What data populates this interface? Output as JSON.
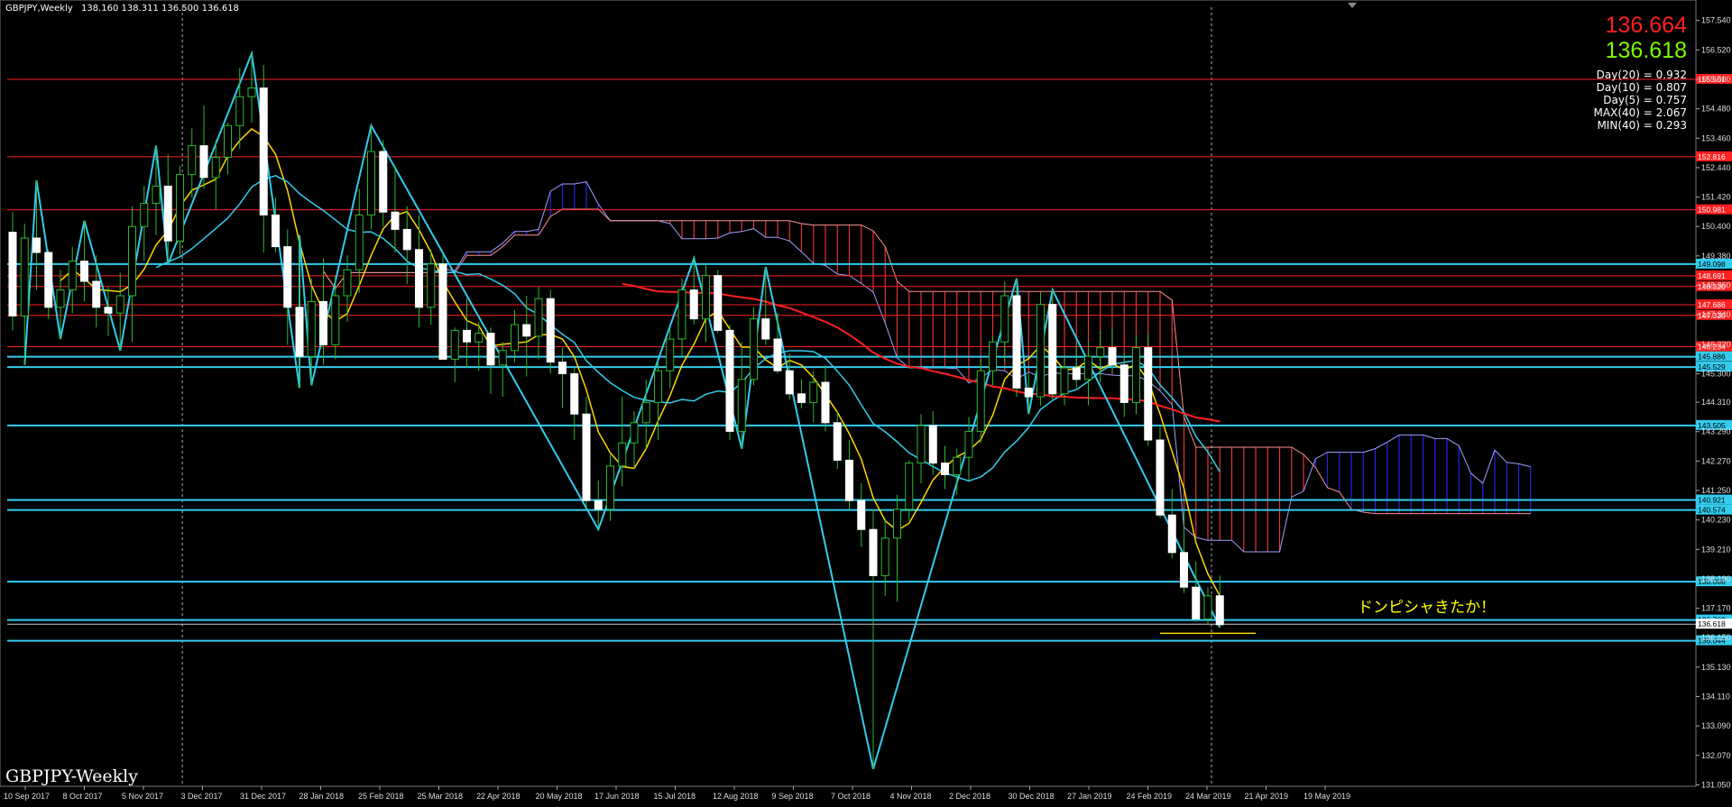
{
  "header": {
    "symbol_tf": "GBPJPY,Weekly",
    "ohlc": "138.160 138.311 136.500 136.618"
  },
  "corner_label": "GBPJPY-Weekly",
  "prices": {
    "bid": "136.664",
    "ask": "136.618",
    "bid_color": "#ff2020",
    "ask_color": "#7cfc00"
  },
  "stats": [
    "Day(20) = 0.932",
    "Day(10) = 0.807",
    "Day(5) = 0.757",
    "MAX(40) = 2.067",
    "MIN(40) = 0.293"
  ],
  "annotation": "ドンピシャきたか！",
  "colors": {
    "background": "#000000",
    "bull_candle": "#ffffff",
    "bear_candle": "#ffffff",
    "wick": "#2eb82e",
    "hline_red": "#ff2020",
    "hline_cyan": "#33ccee",
    "ma_yellow": "#ffd700",
    "ma_cyan": "#33ccee",
    "ma_red": "#ff2020",
    "zigzag": "#33ccee",
    "cloud_bull": "#2a2aff",
    "cloud_bear": "#ff3b3b"
  },
  "chart_data": {
    "type": "candlestick",
    "ylim": [
      131.0,
      158.0
    ],
    "yticks": [
      157.54,
      156.52,
      155.5,
      154.48,
      153.46,
      152.44,
      151.42,
      150.4,
      149.38,
      148.36,
      147.34,
      146.32,
      145.3,
      144.31,
      143.29,
      142.27,
      141.25,
      140.23,
      139.21,
      138.19,
      137.17,
      136.15,
      135.13,
      134.11,
      133.09,
      132.07,
      131.05
    ],
    "x_labels": [
      "10 Sep 2017",
      "8 Oct 2017",
      "5 Nov 2017",
      "3 Dec 2017",
      "31 Dec 2017",
      "28 Jan 2018",
      "25 Feb 2018",
      "25 Mar 2018",
      "22 Apr 2018",
      "20 May 2018",
      "17 Jun 2018",
      "15 Jul 2018",
      "12 Aug 2018",
      "9 Sep 2018",
      "7 Oct 2018",
      "4 Nov 2018",
      "2 Dec 2018",
      "30 Dec 2018",
      "27 Jan 2019",
      "24 Feb 2019",
      "24 Mar 2019",
      "21 Apr 2019",
      "19 May 2019"
    ],
    "price_levels": [
      {
        "value": 155.501,
        "color": "#ff2020",
        "label": "155.501"
      },
      {
        "value": 152.816,
        "color": "#ff2020",
        "label": "152.816"
      },
      {
        "value": 150.981,
        "color": "#ff2020",
        "label": "150.981"
      },
      {
        "value": 149.098,
        "color": "#33ccee",
        "label": "149.098"
      },
      {
        "value": 148.691,
        "color": "#ff2020",
        "label": "148.691"
      },
      {
        "value": 148.32,
        "color": "#ff2020",
        "label": "148.320"
      },
      {
        "value": 147.686,
        "color": "#ff2020",
        "label": "147.686"
      },
      {
        "value": 147.32,
        "color": "#ff2020",
        "label": "147.320"
      },
      {
        "value": 146.234,
        "color": "#ff2020",
        "label": "146.234"
      },
      {
        "value": 145.886,
        "color": "#33ccee",
        "label": "145.886"
      },
      {
        "value": 145.529,
        "color": "#33ccee",
        "label": "145.529"
      },
      {
        "value": 143.505,
        "color": "#33ccee",
        "label": "143.505"
      },
      {
        "value": 140.921,
        "color": "#33ccee",
        "label": "140.921"
      },
      {
        "value": 140.574,
        "color": "#33ccee",
        "label": "140.574"
      },
      {
        "value": 138.088,
        "color": "#33ccee",
        "label": "138.088"
      },
      {
        "value": 136.763,
        "color": "#33ccee",
        "label": "136.763"
      },
      {
        "value": 136.618,
        "color": "#cccccc",
        "label": "136.618"
      },
      {
        "value": 136.044,
        "color": "#33ccee",
        "label": "136.044"
      }
    ],
    "candles": [
      [
        150.2,
        150.9,
        146.8,
        147.3
      ],
      [
        147.3,
        150.5,
        145.6,
        150.0
      ],
      [
        150.0,
        152.0,
        148.2,
        149.5
      ],
      [
        149.5,
        149.6,
        147.2,
        147.6
      ],
      [
        147.6,
        148.9,
        146.5,
        148.2
      ],
      [
        148.2,
        149.7,
        147.4,
        149.2
      ],
      [
        149.2,
        150.6,
        147.8,
        148.5
      ],
      [
        148.5,
        149.4,
        146.9,
        147.6
      ],
      [
        147.6,
        148.3,
        146.6,
        147.4
      ],
      [
        147.4,
        148.8,
        146.1,
        148.0
      ],
      [
        148.0,
        151.1,
        146.4,
        150.4
      ],
      [
        150.4,
        151.8,
        149.2,
        151.2
      ],
      [
        151.2,
        153.2,
        150.1,
        151.8
      ],
      [
        151.8,
        152.9,
        149.1,
        149.9
      ],
      [
        149.9,
        152.5,
        149.4,
        152.2
      ],
      [
        152.2,
        153.8,
        151.4,
        153.2
      ],
      [
        153.2,
        154.6,
        151.7,
        152.1
      ],
      [
        152.1,
        153.4,
        151.0,
        152.8
      ],
      [
        152.8,
        154.0,
        152.2,
        153.9
      ],
      [
        153.9,
        155.9,
        153.1,
        154.9
      ],
      [
        154.9,
        156.4,
        154.0,
        155.2
      ],
      [
        155.2,
        156.0,
        149.5,
        150.8
      ],
      [
        150.8,
        151.4,
        149.5,
        149.7
      ],
      [
        149.7,
        150.3,
        146.3,
        147.6
      ],
      [
        147.6,
        150.1,
        144.8,
        145.9
      ],
      [
        145.9,
        148.6,
        144.9,
        147.8
      ],
      [
        147.8,
        149.3,
        145.6,
        146.3
      ],
      [
        146.3,
        148.7,
        145.8,
        148.0
      ],
      [
        148.0,
        149.4,
        147.1,
        148.9
      ],
      [
        148.9,
        151.7,
        148.1,
        150.8
      ],
      [
        150.8,
        153.9,
        150.3,
        153.0
      ],
      [
        153.0,
        153.4,
        150.4,
        150.9
      ],
      [
        150.9,
        152.5,
        149.5,
        150.3
      ],
      [
        150.3,
        151.1,
        148.4,
        149.6
      ],
      [
        149.6,
        150.8,
        146.9,
        147.6
      ],
      [
        147.6,
        149.6,
        147.0,
        149.1
      ],
      [
        149.1,
        149.4,
        146.2,
        145.8
      ],
      [
        145.8,
        146.9,
        145.0,
        146.8
      ],
      [
        146.8,
        147.9,
        145.5,
        146.4
      ],
      [
        146.4,
        147.1,
        145.4,
        146.7
      ],
      [
        146.7,
        146.9,
        144.6,
        145.6
      ],
      [
        145.6,
        146.4,
        144.5,
        146.1
      ],
      [
        146.1,
        147.5,
        145.7,
        147.0
      ],
      [
        147.0,
        148.0,
        145.2,
        146.6
      ],
      [
        146.6,
        148.3,
        145.8,
        147.9
      ],
      [
        147.9,
        148.2,
        145.3,
        145.7
      ],
      [
        145.7,
        146.2,
        144.1,
        145.3
      ],
      [
        145.3,
        145.5,
        143.0,
        143.9
      ],
      [
        143.9,
        144.5,
        140.6,
        140.9
      ],
      [
        140.9,
        141.6,
        139.9,
        140.6
      ],
      [
        140.6,
        142.5,
        140.2,
        142.1
      ],
      [
        142.1,
        144.5,
        141.4,
        142.9
      ],
      [
        142.9,
        144.0,
        142.0,
        143.6
      ],
      [
        143.6,
        145.1,
        142.7,
        144.3
      ],
      [
        144.3,
        145.7,
        143.0,
        145.4
      ],
      [
        145.4,
        146.9,
        144.8,
        146.5
      ],
      [
        146.5,
        148.6,
        145.9,
        148.2
      ],
      [
        148.2,
        149.3,
        147.0,
        147.2
      ],
      [
        147.2,
        149.1,
        146.4,
        148.7
      ],
      [
        148.7,
        148.9,
        146.7,
        146.8
      ],
      [
        146.8,
        147.0,
        143.0,
        143.3
      ],
      [
        143.3,
        146.4,
        142.7,
        145.1
      ],
      [
        145.1,
        147.6,
        144.9,
        147.2
      ],
      [
        147.2,
        149.0,
        146.3,
        146.5
      ],
      [
        146.5,
        147.4,
        145.3,
        145.4
      ],
      [
        145.4,
        146.0,
        144.4,
        144.6
      ],
      [
        144.6,
        145.1,
        144.1,
        144.3
      ],
      [
        144.3,
        145.4,
        143.6,
        145.0
      ],
      [
        145.0,
        145.6,
        143.3,
        143.6
      ],
      [
        143.6,
        144.0,
        142.0,
        142.3
      ],
      [
        142.3,
        143.0,
        140.6,
        140.9
      ],
      [
        140.9,
        141.5,
        139.3,
        139.9
      ],
      [
        139.9,
        140.6,
        131.6,
        138.3
      ],
      [
        138.3,
        140.3,
        137.6,
        139.6
      ],
      [
        139.6,
        141.1,
        137.4,
        140.6
      ],
      [
        140.6,
        142.3,
        140.2,
        142.2
      ],
      [
        142.2,
        143.9,
        141.5,
        143.5
      ],
      [
        143.5,
        144.0,
        141.8,
        142.2
      ],
      [
        142.2,
        142.8,
        141.3,
        141.8
      ],
      [
        141.8,
        142.7,
        141.1,
        142.4
      ],
      [
        142.4,
        143.8,
        141.6,
        143.3
      ],
      [
        143.3,
        145.8,
        142.9,
        145.4
      ],
      [
        145.4,
        146.6,
        144.9,
        146.4
      ],
      [
        146.4,
        148.5,
        145.7,
        148.0
      ],
      [
        148.0,
        148.6,
        144.5,
        144.8
      ],
      [
        144.8,
        145.3,
        143.9,
        144.5
      ],
      [
        144.5,
        148.1,
        144.2,
        147.7
      ],
      [
        147.7,
        148.2,
        144.4,
        144.6
      ],
      [
        144.6,
        145.9,
        144.2,
        145.5
      ],
      [
        145.5,
        146.4,
        144.8,
        145.1
      ],
      [
        145.1,
        146.4,
        144.2,
        145.9
      ],
      [
        145.9,
        146.8,
        145.0,
        146.2
      ],
      [
        146.2,
        146.9,
        145.3,
        145.6
      ],
      [
        145.6,
        146.0,
        143.8,
        144.3
      ],
      [
        144.3,
        146.6,
        143.9,
        146.2
      ],
      [
        146.2,
        146.7,
        142.8,
        143.0
      ],
      [
        143.0,
        143.5,
        140.3,
        140.4
      ],
      [
        140.4,
        141.3,
        138.9,
        139.1
      ],
      [
        139.1,
        140.5,
        137.7,
        137.9
      ],
      [
        137.9,
        138.8,
        136.7,
        136.8
      ],
      [
        136.8,
        137.9,
        136.6,
        137.6
      ],
      [
        137.6,
        138.3,
        136.5,
        136.6
      ]
    ]
  }
}
